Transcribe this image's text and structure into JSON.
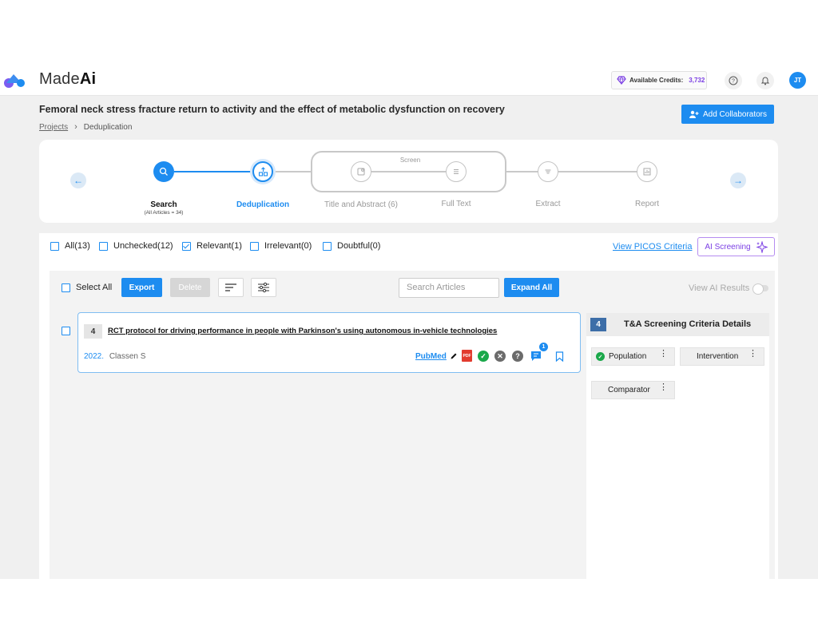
{
  "app": {
    "brand_prefix": "Made",
    "brand_bold": "Ai",
    "credits_label": "Available Credits:",
    "credits_value": "3,732",
    "avatar_initials": "JT"
  },
  "project": {
    "title": "Femoral neck stress fracture return to activity and the effect of metabolic dysfunction on recovery",
    "breadcrumb": [
      "Projects",
      "Deduplication"
    ],
    "add_collaborators": "Add Collaborators"
  },
  "stepper": {
    "screen_group_label": "Screen",
    "steps": [
      {
        "label": "Search",
        "sub": "(All Articles = 34)",
        "state": "done"
      },
      {
        "label": "Deduplication",
        "state": "current"
      },
      {
        "label": "Title and Abstract (6)",
        "state": "todo"
      },
      {
        "label": "Full Text",
        "state": "todo"
      },
      {
        "label": "Extract",
        "state": "todo"
      },
      {
        "label": "Report",
        "state": "todo"
      }
    ]
  },
  "filters": {
    "items": [
      {
        "label": "All(13)",
        "checked": false
      },
      {
        "label": "Unchecked(12)",
        "checked": false
      },
      {
        "label": "Relevant(1)",
        "checked": true
      },
      {
        "label": "Irrelevant(0)",
        "checked": false
      },
      {
        "label": "Doubtful(0)",
        "checked": false
      }
    ],
    "picos_link": "View PICOS Criteria",
    "ai_screening": "AI Screening"
  },
  "toolbar": {
    "select_all": "Select All",
    "export": "Export",
    "delete": "Delete",
    "search_placeholder": "Search Articles",
    "expand_all": "Expand All",
    "view_ai_results": "View AI Results"
  },
  "articles": [
    {
      "number": "4",
      "title": "RCT protocol for driving performance in people with Parkinson's using autonomous in-vehicle technologies",
      "year": "2022.",
      "author": "Classen S",
      "source": "PubMed",
      "pdf_label": "PDF",
      "comment_count": "1"
    }
  ],
  "criteria_panel": {
    "number": "4",
    "title": "T&A Screening Criteria Details",
    "chips": [
      "Population",
      "Intervention",
      "Comparator"
    ]
  },
  "colors": {
    "accent": "#1d8cf0",
    "ai_purple": "#7b3fe4",
    "success": "#1aa84a"
  }
}
